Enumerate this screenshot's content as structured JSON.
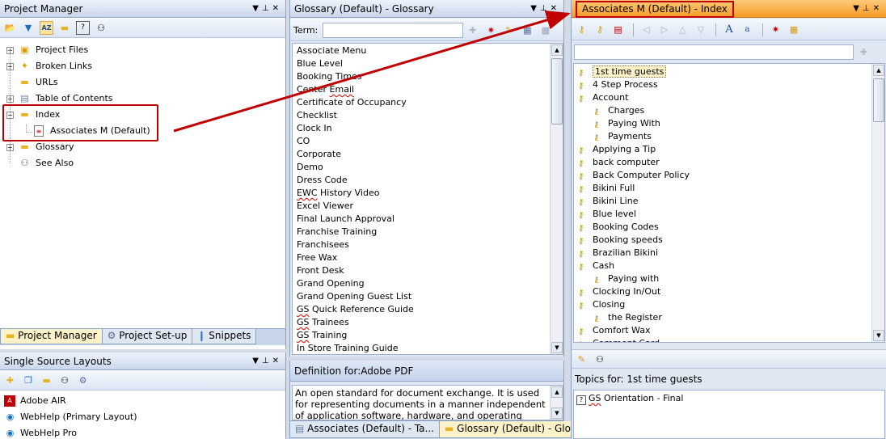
{
  "colors": {
    "accent_active": "#f59a26",
    "callout_red": "#c00000",
    "panel_title_bg": "#c9d7ec"
  },
  "project_manager": {
    "title": "Project Manager",
    "toolbar_icons": [
      "open-folder-icon",
      "filter-icon",
      "sort-az-icon",
      "folder-icon",
      "help-icon",
      "binoculars-icon"
    ],
    "tree": [
      {
        "label": "Project Files",
        "icon": "project-files-icon",
        "expander": "+"
      },
      {
        "label": "Broken Links",
        "icon": "broken-links-icon",
        "expander": "+"
      },
      {
        "label": "URLs",
        "icon": "url-folder-icon",
        "expander": ""
      },
      {
        "label": "Table of Contents",
        "icon": "toc-book-icon",
        "expander": "+"
      },
      {
        "label": "Index",
        "icon": "index-folder-icon",
        "expander": "-"
      },
      {
        "label": "Associates M (Default)",
        "icon": "index-file-icon",
        "expander": ""
      },
      {
        "label": "Glossary",
        "icon": "glossary-folder-icon",
        "expander": "+"
      },
      {
        "label": "See Also",
        "icon": "see-also-icon",
        "expander": ""
      }
    ],
    "tabs": [
      "Project Manager",
      "Project Set-up",
      "Snippets"
    ]
  },
  "single_source": {
    "title": "Single Source Layouts",
    "toolbar_icons": [
      "new-layout-icon",
      "copy-layout-icon",
      "folder-icon",
      "view-icon",
      "settings-icon"
    ],
    "items": [
      {
        "label": "Adobe AIR",
        "icon": "adobe-air-icon"
      },
      {
        "label": "WebHelp (Primary Layout)",
        "icon": "globe-icon"
      },
      {
        "label": "WebHelp Pro",
        "icon": "globe-icon"
      }
    ]
  },
  "glossary": {
    "title": "Glossary (Default) - Glossary",
    "term_label": "Term:",
    "term_value": "",
    "terms": [
      "Associate Menu",
      "Blue Level",
      "Booking Times",
      "Center Email",
      "Certificate of Occupancy",
      "Checklist",
      "Clock In",
      "CO",
      "Corporate",
      "Demo",
      "Dress Code",
      "EWC History Video",
      "Excel Viewer",
      "Final Launch Approval",
      "Franchise Training",
      "Franchisees",
      "Free Wax",
      "Front Desk",
      "Grand Opening",
      "Grand Opening Guest List",
      "GS Quick Reference Guide",
      "GS Trainees",
      "GS Training",
      "In Store Training Guide"
    ],
    "definition_title": "Definition for:Adobe PDF",
    "definition_text": "An open standard for document exchange. It is used for representing documents in a manner independent of application software, hardware, and operating systems.",
    "bottom_tabs": [
      "Associates (Default) - Ta...",
      "Glossary (Default) - Glos..."
    ]
  },
  "index": {
    "title": "Associates M (Default) - Index",
    "search_value": "",
    "entries": [
      {
        "label": "1st time guests",
        "level": 0,
        "selected": true
      },
      {
        "label": "4 Step Process",
        "level": 0
      },
      {
        "label": "Account",
        "level": 0
      },
      {
        "label": "Charges",
        "level": 1
      },
      {
        "label": "Paying With",
        "level": 1
      },
      {
        "label": "Payments",
        "level": 1
      },
      {
        "label": "Applying a Tip",
        "level": 0
      },
      {
        "label": "back computer",
        "level": 0
      },
      {
        "label": "Back Computer Policy",
        "level": 0
      },
      {
        "label": "Bikini Full",
        "level": 0
      },
      {
        "label": "Bikini Line",
        "level": 0
      },
      {
        "label": "Blue level",
        "level": 0
      },
      {
        "label": "Booking Codes",
        "level": 0
      },
      {
        "label": "Booking speeds",
        "level": 0
      },
      {
        "label": "Brazilian Bikini",
        "level": 0
      },
      {
        "label": "Cash",
        "level": 0
      },
      {
        "label": "Paying with",
        "level": 1
      },
      {
        "label": "Clocking In/Out",
        "level": 0
      },
      {
        "label": "Closing",
        "level": 0
      },
      {
        "label": "the Register",
        "level": 1
      },
      {
        "label": "Comfort Wax",
        "level": 0
      },
      {
        "label": "Comment Card",
        "level": 0
      }
    ],
    "topics_title": "Topics for: 1st time guests",
    "topics": [
      {
        "label": "GS Orientation - Final",
        "icon": "help-topic-icon"
      }
    ]
  }
}
